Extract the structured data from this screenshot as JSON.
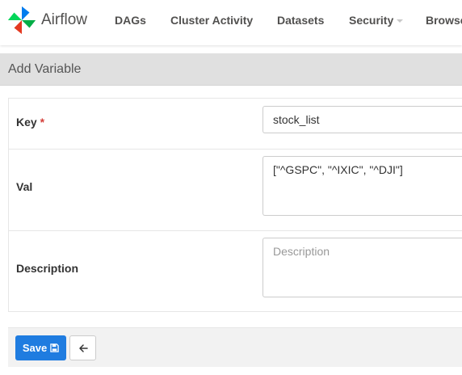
{
  "navbar": {
    "brand": "Airflow",
    "items": [
      {
        "label": "DAGs",
        "icon": "none"
      },
      {
        "label": "Cluster Activity",
        "icon": "none"
      },
      {
        "label": "Datasets",
        "icon": "none"
      },
      {
        "label": "Security",
        "icon": "chevron-down-icon"
      },
      {
        "label": "Browse",
        "icon": "none"
      }
    ]
  },
  "panel": {
    "title": "Add Variable"
  },
  "form": {
    "key": {
      "label": "Key",
      "required_mark": "*",
      "value": "stock_list"
    },
    "val": {
      "label": "Val",
      "value": "[\"^GSPC\", \"^IXIC\", \"^DJI\"]"
    },
    "description": {
      "label": "Description",
      "placeholder": "Description",
      "value": ""
    }
  },
  "actions": {
    "save_label": "Save",
    "save_icon": "floppy-disk-icon",
    "back_icon": "arrow-left-icon"
  },
  "colors": {
    "primary": "#1f7ce0",
    "required": "#d43f3a",
    "heading_bg": "#e0e0e0",
    "nav_text": "#51504f"
  }
}
